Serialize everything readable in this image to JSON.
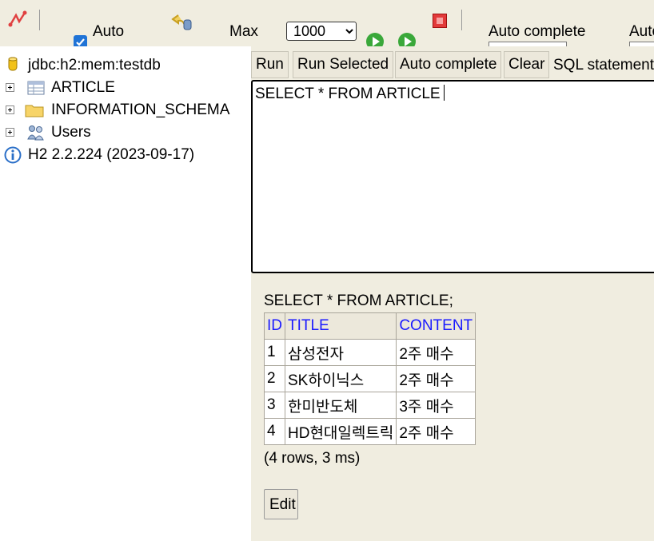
{
  "toolbar": {
    "auto_commit_label": "Auto",
    "auto_commit_checked": true,
    "max_label": "Max",
    "max_rows_value": "1000",
    "auto_complete_label": "Auto complete",
    "auto_select_label": "Auto"
  },
  "tree": {
    "connection": "jdbc:h2:mem:testdb",
    "items": [
      {
        "label": "ARTICLE",
        "icon": "table-icon"
      },
      {
        "label": "INFORMATION_SCHEMA",
        "icon": "folder-icon"
      },
      {
        "label": "Users",
        "icon": "users-icon"
      }
    ],
    "version": "H2 2.2.224 (2023-09-17)"
  },
  "query_toolbar": {
    "run": "Run",
    "run_selected": "Run Selected",
    "auto_complete": "Auto complete",
    "clear": "Clear",
    "sql_label": "SQL statement"
  },
  "editor": {
    "text": "SELECT * FROM ARTICLE"
  },
  "result": {
    "query": "SELECT * FROM ARTICLE;",
    "columns": [
      "ID",
      "TITLE",
      "CONTENT"
    ],
    "rows": [
      [
        "1",
        "삼성전자",
        "2주 매수"
      ],
      [
        "2",
        "SK하이닉스",
        "2주 매수"
      ],
      [
        "3",
        "한미반도체",
        "3주 매수"
      ],
      [
        "4",
        "HD현대일렉트릭",
        "2주 매수"
      ]
    ],
    "row_info": "(4 rows, 3 ms)",
    "edit": "Edit"
  },
  "colors": {
    "panel_bg": "#f0ede0",
    "header_link": "#1a1aff",
    "run_green": "#3aa83a",
    "stop_red": "#e23a3a"
  }
}
